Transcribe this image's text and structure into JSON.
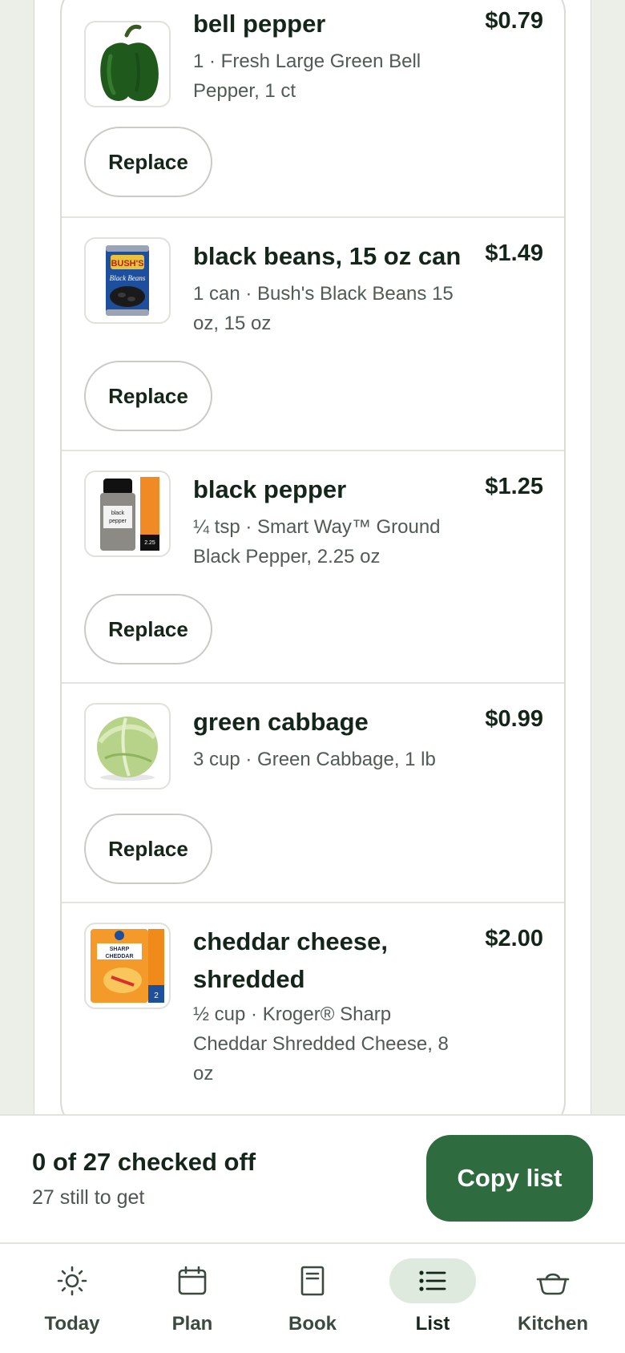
{
  "shopping_list": {
    "items": [
      {
        "name": "bell pepper",
        "price": "$0.79",
        "description": "1 · Fresh Large Green Bell Pepper, 1 ct",
        "image": "green-bell-pepper",
        "replace_label": "Replace"
      },
      {
        "name": "black beans, 15 oz can",
        "price": "$1.49",
        "description": "1 can · Bush's Black Beans 15 oz, 15 oz",
        "image": "black-beans-can",
        "replace_label": "Replace"
      },
      {
        "name": "black pepper",
        "price": "$1.25",
        "description": "¼ tsp · Smart Way™ Ground Black Pepper, 2.25 oz",
        "image": "black-pepper-shaker",
        "replace_label": "Replace"
      },
      {
        "name": "green cabbage",
        "price": "$0.99",
        "description": "3 cup · Green Cabbage, 1 lb",
        "image": "green-cabbage",
        "replace_label": "Replace"
      },
      {
        "name": "cheddar cheese, shredded",
        "price": "$2.00",
        "description": "½ cup · Kroger® Sharp Cheddar Shredded Cheese, 8 oz",
        "image": "shredded-cheddar-bag"
      }
    ]
  },
  "summary": {
    "checked_text": "0 of 27 checked off",
    "remaining_text": "27 still to get",
    "copy_button_label": "Copy list"
  },
  "tabs": [
    {
      "label": "Today",
      "icon": "sun-icon",
      "active": false
    },
    {
      "label": "Plan",
      "icon": "calendar-icon",
      "active": false
    },
    {
      "label": "Book",
      "icon": "book-icon",
      "active": false
    },
    {
      "label": "List",
      "icon": "list-icon",
      "active": true
    },
    {
      "label": "Kitchen",
      "icon": "pot-icon",
      "active": false
    }
  ],
  "colors": {
    "brand_green": "#2e6b3f",
    "active_tab_bg": "#dfeadf",
    "page_bg": "#ecefe8"
  }
}
